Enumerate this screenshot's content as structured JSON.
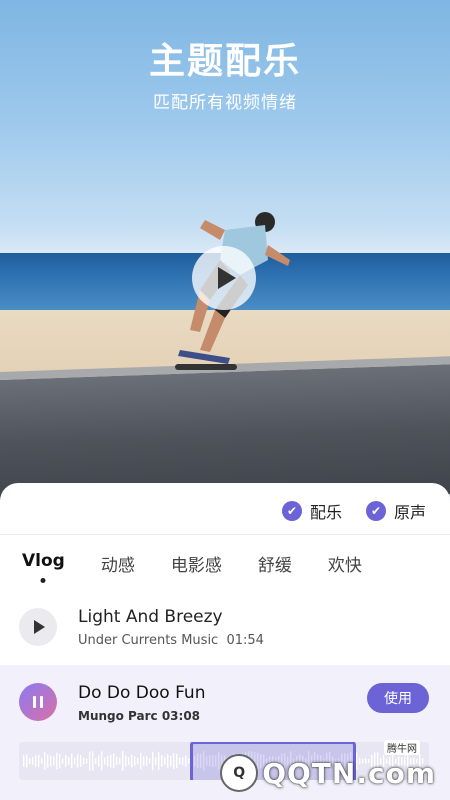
{
  "hero": {
    "title": "主题配乐",
    "subtitle": "匹配所有视频情绪"
  },
  "options": {
    "music_label": "配乐",
    "original_label": "原声"
  },
  "tabs": [
    {
      "label": "Vlog",
      "active": true
    },
    {
      "label": "动感"
    },
    {
      "label": "电影感"
    },
    {
      "label": "舒缓"
    },
    {
      "label": "欢快"
    }
  ],
  "tracks": [
    {
      "title": "Light And Breezy",
      "artist": "Under Currents Music",
      "duration": "01:54"
    },
    {
      "title": "Do Do Doo Fun",
      "artist": "Mungo Parc",
      "duration": "03:08",
      "action": "使用"
    }
  ],
  "watermark": {
    "logo_text": "Q",
    "site": "QQTN.com",
    "small": "腾牛网"
  },
  "colors": {
    "accent": "#6b63d6"
  }
}
